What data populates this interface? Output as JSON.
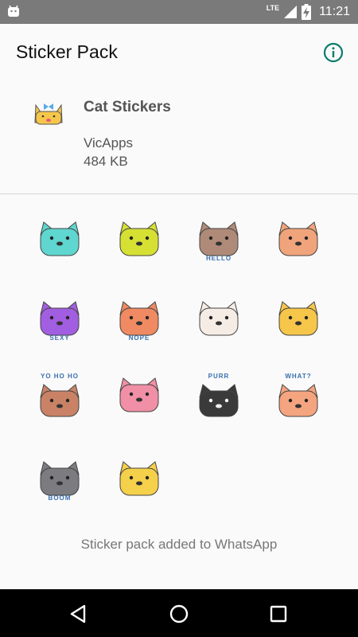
{
  "status_bar": {
    "time": "11:21",
    "network": "LTE"
  },
  "app_bar": {
    "title": "Sticker Pack",
    "info_icon": "info-icon"
  },
  "pack": {
    "name": "Cat Stickers",
    "publisher": "VicApps",
    "size": "484 KB"
  },
  "stickers": [
    {
      "color": "#5fd6cf",
      "caption": ""
    },
    {
      "color": "#d6e033",
      "caption": ""
    },
    {
      "color": "#b08a78",
      "caption": "HELLO"
    },
    {
      "color": "#f0a47c",
      "caption": ""
    },
    {
      "color": "#a25ee0",
      "caption": "SEXY"
    },
    {
      "color": "#ef8a62",
      "caption": "NOPE"
    },
    {
      "color": "#f6ece6",
      "caption": ""
    },
    {
      "color": "#f6c64a",
      "caption": ""
    },
    {
      "color": "#c98265",
      "caption": "YO HO HO"
    },
    {
      "color": "#f08fa6",
      "caption": ""
    },
    {
      "color": "#3a3a3a",
      "caption": "PURR"
    },
    {
      "color": "#f4a47f",
      "caption": "WHAT?"
    },
    {
      "color": "#7b7b80",
      "caption": "BOOM"
    },
    {
      "color": "#f5d04a",
      "caption": ""
    }
  ],
  "footer": {
    "message": "Sticker pack added to WhatsApp"
  },
  "nav": {
    "back_icon": "back-icon",
    "home_icon": "home-icon",
    "recents_icon": "recents-icon"
  }
}
